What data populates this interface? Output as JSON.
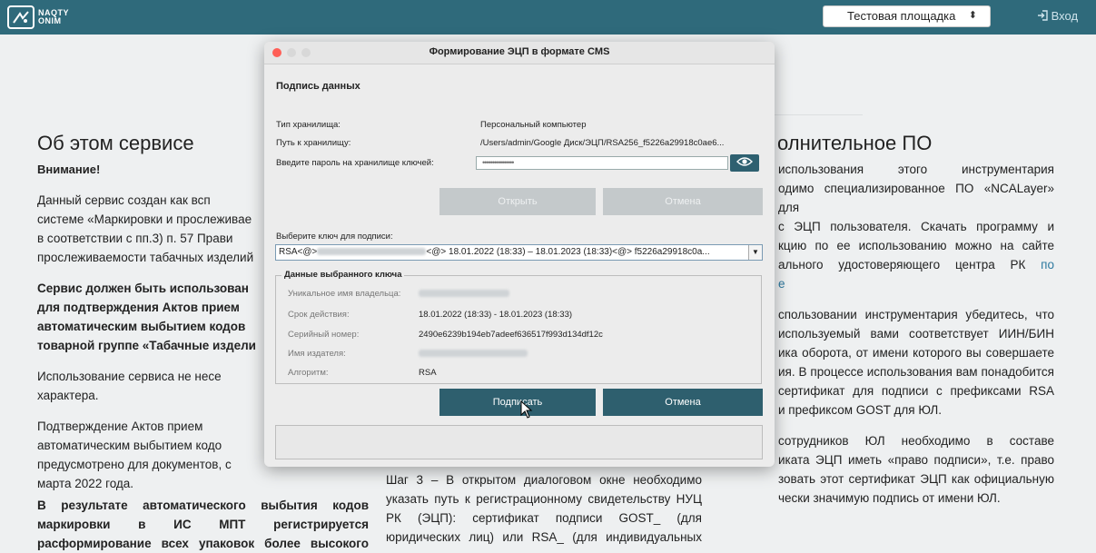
{
  "header": {
    "logo_line1": "NAQTY",
    "logo_line2": "ONIM",
    "site_select": "Тестовая площадка",
    "login_label": "Вход"
  },
  "page": {
    "left_heading": "Об этом сервисе",
    "right_heading": "олнительное ПО",
    "left_paragraphs": [
      "Внимание!",
      "Данный сервис создан как всп",
      "системе «Маркировки и прослеживае",
      "в соответствии с пп.3) п. 57 Прави",
      "прослеживаемости табачных изделий",
      "Сервис должен быть использован",
      "для подтверждения Актов прием",
      "автоматическим выбытием кодов",
      "товарной группе «Табачные издели",
      "Использование сервиса не несе",
      "характера.",
      "Подтверждение Актов прием",
      "автоматическим выбытием кодо",
      "предусмотрено для документов, с",
      "марта 2022 года.",
      "В результате автоматического выбытия кодов",
      "маркировки в ИС МПТ регистрируется",
      "расформирование всех упаковок более высокого"
    ],
    "right_paragraphs": [
      "использования этого инструментария",
      "одимо специализированное ПО «NCALayer» для",
      "с ЭЦП пользователя. Скачать программу и",
      "кцию по ее использованию можно на сайте",
      "ального удостоверяющего центра РК",
      "по",
      "е",
      "спользовании инструментария убедитесь, что",
      "используемый вами соответствует ИИН/БИН",
      "ика оборота, от имени которого вы совершаете",
      "ия. В процессе использования вам понадобится",
      "сертификат для подписи с префиксами RSA",
      "и префиксом GOST для ЮЛ.",
      "сотрудников ЮЛ необходимо в составе",
      "иката ЭЦП иметь «право подписи», т.е. право",
      "зовать этот сертификат ЭЦП как официальную",
      "чески значимую подпись от имени ЮЛ."
    ],
    "middle_paragraphs": [
      "Шаг 3 – В открытом диалоговом окне необходимо",
      "указать путь к регистрационному свидетельству НУЦ",
      "РК (ЭЦП): сертификат подписи GOST_ (для",
      "юридических лиц) или RSA_ (для индивидуальных"
    ]
  },
  "dialog": {
    "title": "Формирование ЭЦП в формате CMS",
    "section_title": "Подпись данных",
    "storage_type_label": "Тип хранилища:",
    "storage_type_value": "Персональный компьютер",
    "storage_path_label": "Путь к хранилищу:",
    "storage_path_value": "/Users/admin/Google Диск/ЭЦП/RSA256_f5226a29918c0ae6...",
    "password_label": "Введите пароль на хранилище ключей:",
    "password_value": "••••••••••••••••",
    "open_button": "Открыть",
    "cancel_top_button": "Отмена",
    "key_select_label": "Выберите ключ для подписи:",
    "key_prefix": "RSA<@>",
    "key_suffix": "<@> 18.01.2022 (18:33) – 18.01.2023 (18:33)<@> f5226a29918c0a...",
    "key_data_legend": "Данные выбранного ключа",
    "owner_label": "Уникальное имя владельца:",
    "validity_label": "Срок действия:",
    "validity_value": "18.01.2022 (18:33) - 18.01.2023 (18:33)",
    "serial_label": "Серийный номер:",
    "serial_value": "2490e6239b194eb7adeef636517f993d134df12c",
    "issuer_label": "Имя издателя:",
    "algorithm_label": "Алгоритм:",
    "algorithm_value": "RSA",
    "sign_button": "Подписать",
    "cancel_button": "Отмена"
  },
  "colors": {
    "topbar": "#2f6a7b",
    "primary_button": "#2e5f6e",
    "disabled_button": "#c4c9cb",
    "link": "#2f7aa0"
  },
  "icons": [
    "logo-icon",
    "chevron-updown-icon",
    "login-icon",
    "eye-icon",
    "chevron-down-icon",
    "mouse-cursor-icon"
  ]
}
